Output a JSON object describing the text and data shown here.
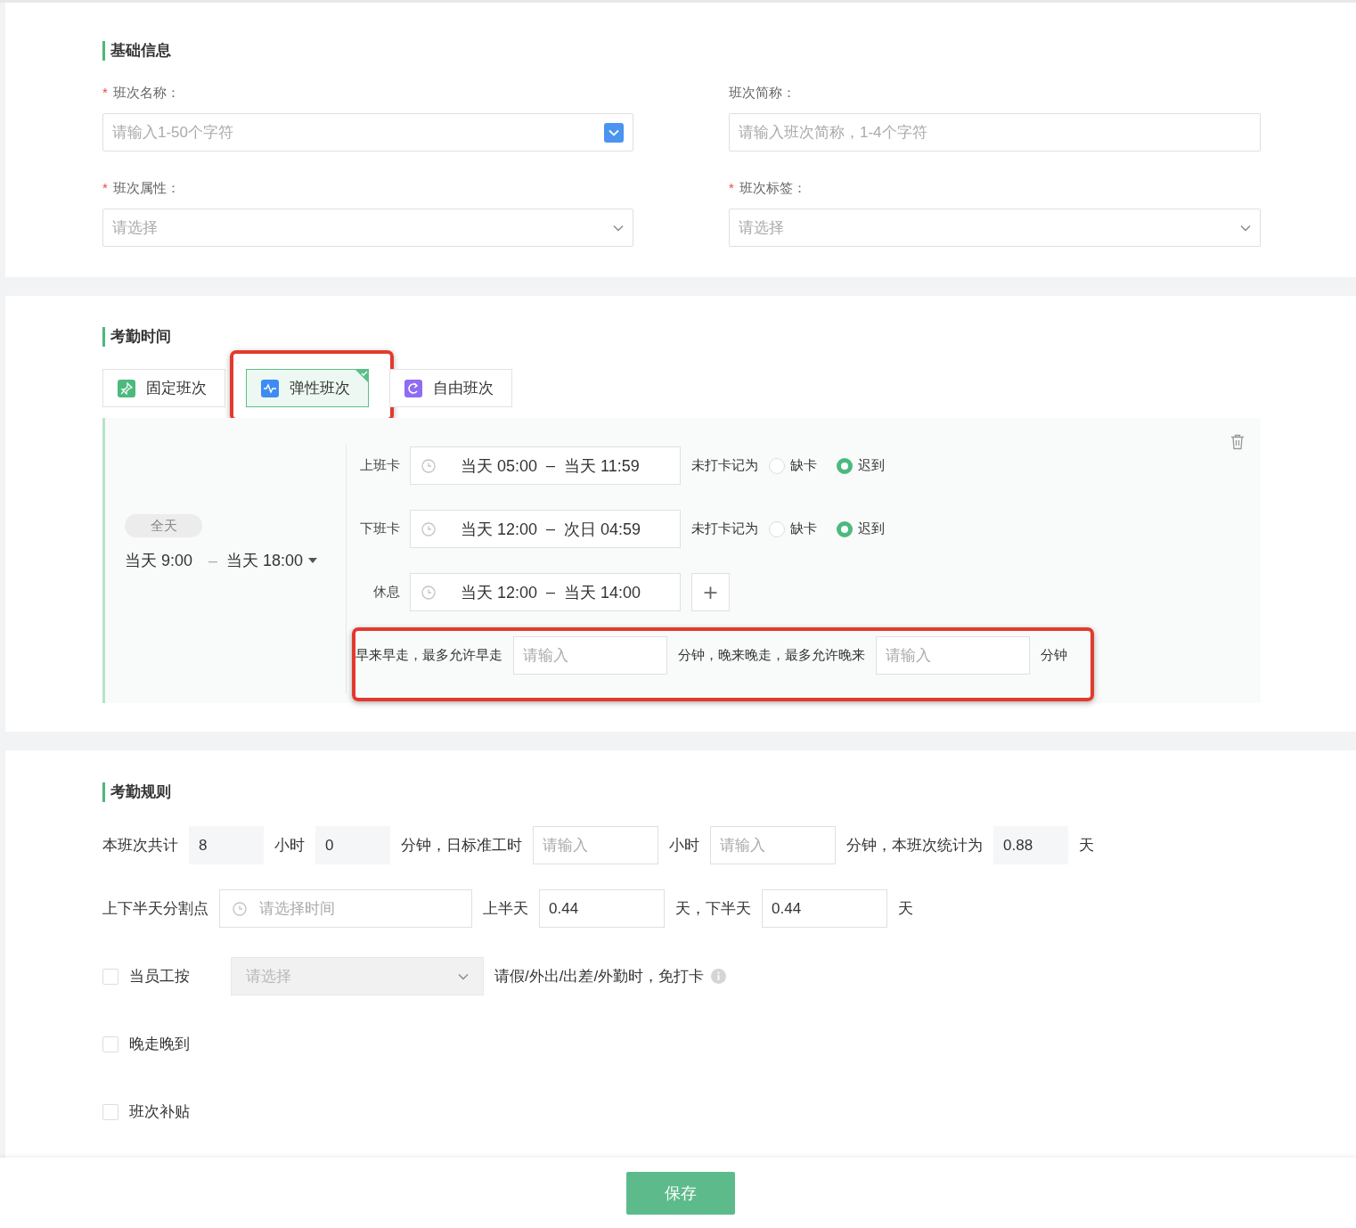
{
  "basic_info": {
    "title": "基础信息",
    "fields": [
      {
        "kind": "input_picker",
        "required_mark": "*",
        "label": "班次名称：",
        "placeholder": "请输入1-50个字符"
      },
      {
        "kind": "input",
        "label": "班次简称：",
        "placeholder": "请输入班次简称，1-4个字符"
      },
      {
        "kind": "select",
        "required_mark": "*",
        "label": "班次属性：",
        "placeholder": "请选择"
      },
      {
        "kind": "select",
        "required_mark": "*",
        "label": "班次标签：",
        "placeholder": "请选择"
      }
    ]
  },
  "attendance_time": {
    "title": "考勤时间",
    "shift_types": [
      {
        "kind": "fixed",
        "label": "固定班次",
        "color": "#4cb97d",
        "selected": false,
        "highlighted": false
      },
      {
        "kind": "flexible",
        "label": "弹性班次",
        "color": "#3d8cf2",
        "selected": true,
        "highlighted": true
      },
      {
        "kind": "free",
        "label": "自由班次",
        "color": "#8f6cf3",
        "selected": false,
        "highlighted": false
      }
    ],
    "period": {
      "tag": "全天",
      "start": "当天 9:00",
      "separator": "–",
      "end": "当天 18:00"
    },
    "punch_rows": [
      {
        "kind": "punch",
        "label": "上班卡",
        "start": "当天 05:00",
        "separator": "–",
        "end": "当天 11:59",
        "missing_label": "未打卡记为",
        "options": [
          {
            "label": "缺卡",
            "selected": false
          },
          {
            "label": "迟到",
            "selected": true
          }
        ]
      },
      {
        "kind": "punch",
        "label": "下班卡",
        "start": "当天 12:00",
        "separator": "–",
        "end": "次日 04:59",
        "missing_label": "未打卡记为",
        "options": [
          {
            "label": "缺卡",
            "selected": false
          },
          {
            "label": "迟到",
            "selected": true
          }
        ]
      },
      {
        "kind": "break",
        "label": "休息",
        "start": "当天 12:00",
        "separator": "–",
        "end": "当天 14:00",
        "add_button": "+"
      }
    ],
    "tolerance": {
      "highlighted": true,
      "early_label": "早来早走，最多允许早走",
      "early_placeholder": "请输入",
      "late_label": "分钟，晚来晚走，最多允许晚来",
      "late_placeholder": "请输入",
      "unit": "分钟"
    }
  },
  "attendance_rules": {
    "title": "考勤规则",
    "rows": [
      {
        "items": [
          {
            "kind": "text",
            "text": "本班次共计"
          },
          {
            "kind": "field",
            "value": "8",
            "disabled": true
          },
          {
            "kind": "text",
            "text": "小时"
          },
          {
            "kind": "field",
            "value": "0",
            "disabled": true
          },
          {
            "kind": "text",
            "text": "分钟，日标准工时"
          },
          {
            "kind": "field",
            "placeholder": "请输入",
            "disabled": false
          },
          {
            "kind": "text",
            "text": "小时"
          },
          {
            "kind": "field",
            "placeholder": "请输入",
            "disabled": false
          },
          {
            "kind": "text",
            "text": "分钟，本班次统计为"
          },
          {
            "kind": "field",
            "value": "0.88",
            "disabled": true
          },
          {
            "kind": "text",
            "text": "天"
          }
        ]
      },
      {
        "items": [
          {
            "kind": "text",
            "text": "上下半天分割点"
          },
          {
            "kind": "time",
            "placeholder": "请选择时间",
            "disabled": false
          },
          {
            "kind": "text",
            "text": "上半天"
          },
          {
            "kind": "field",
            "value": "0.44",
            "disabled": false
          },
          {
            "kind": "text",
            "text": "天，下半天"
          },
          {
            "kind": "field",
            "value": "0.44",
            "disabled": false
          },
          {
            "kind": "text",
            "text": "天"
          }
        ]
      }
    ],
    "options": [
      {
        "label": "当员工按",
        "checked": false,
        "select_placeholder": "请选择",
        "select_disabled": true,
        "note": "请假/外出/出差/外勤时，免打卡",
        "info": true
      },
      {
        "label": "晚走晚到",
        "checked": false
      },
      {
        "label": "班次补贴",
        "checked": false
      }
    ]
  },
  "footer": {
    "save_button": "保存"
  }
}
